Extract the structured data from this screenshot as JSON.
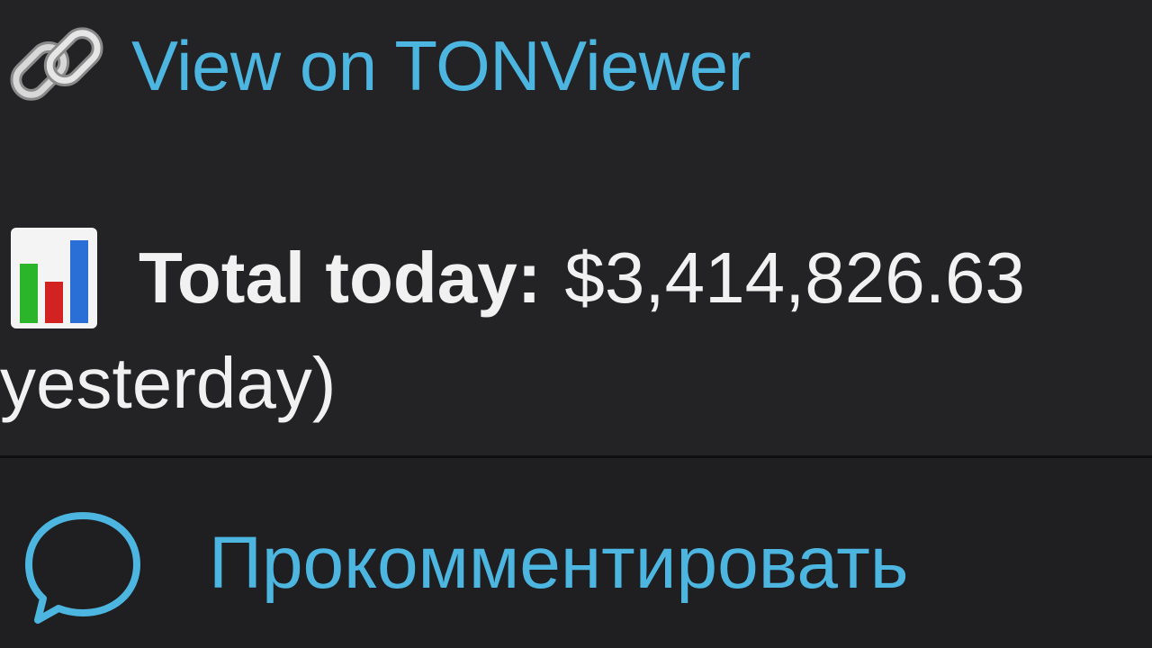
{
  "message": {
    "link": {
      "icon": "link-chain-icon",
      "label": "View on TONViewer"
    },
    "stats": {
      "icon": "bar-chart-icon",
      "label": "Total today:",
      "value": "$3,414,826.63",
      "continuation": "yesterday)"
    }
  },
  "comment_bar": {
    "icon": "speech-bubble-icon",
    "label": "Прокомментировать"
  },
  "colors": {
    "background": "#212023",
    "link_accent": "#4cb6e0",
    "text": "#f1f1f1",
    "chart_green": "#2bb52b",
    "chart_red": "#d22222",
    "chart_blue": "#2a6fd6"
  }
}
